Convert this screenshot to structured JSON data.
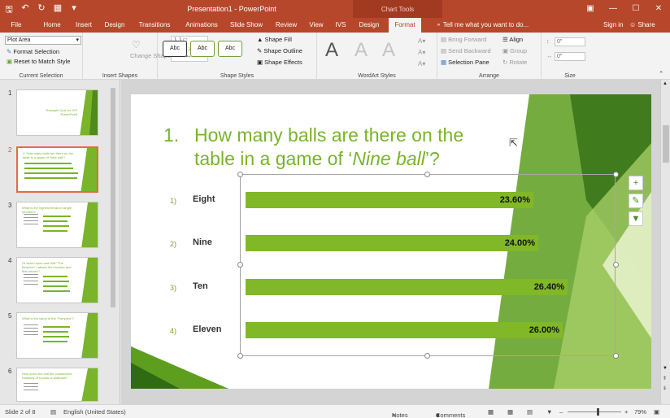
{
  "titlebar": {
    "doc_title": "Presentation1 - PowerPoint",
    "context_tab_group": "Chart Tools",
    "qat": [
      "save-icon",
      "undo-icon",
      "redo-icon",
      "start-from-beginning-icon",
      "customize-icon"
    ],
    "win_buttons": [
      "ribbon-display-icon",
      "minimize-icon",
      "maximize-icon",
      "close-icon"
    ]
  },
  "tabs": {
    "file": "File",
    "home": "Home",
    "insert": "Insert",
    "design": "Design",
    "transitions": "Transitions",
    "animations": "Animations",
    "slideshow": "Slide Show",
    "review": "Review",
    "view": "View",
    "ivs": "IVS",
    "chart_design": "Design",
    "format": "Format",
    "tell_me": "Tell me what you want to do...",
    "sign_in": "Sign in",
    "share": "Share"
  },
  "ribbon": {
    "current_selection": {
      "dropdown_value": "Plot Area",
      "format_selection": "Format Selection",
      "reset": "Reset to Match Style",
      "label": "Current Selection"
    },
    "insert_shapes": {
      "change_shape": "Change Shape",
      "label": "Insert Shapes"
    },
    "shape_styles": {
      "preset_labels": [
        "Abc",
        "Abc",
        "Abc"
      ],
      "fill": "Shape Fill",
      "outline": "Shape Outline",
      "effects": "Shape Effects",
      "label": "Shape Styles"
    },
    "wordart": {
      "letters": [
        "A",
        "A",
        "A"
      ],
      "label": "WordArt Styles"
    },
    "arrange": {
      "bring_forward": "Bring Forward",
      "send_backward": "Send Backward",
      "selection_pane": "Selection Pane",
      "align": "Align",
      "group": "Group",
      "rotate": "Rotate",
      "label": "Arrange"
    },
    "size": {
      "height": "0\"",
      "width": "0\"",
      "label": "Size"
    }
  },
  "thumbnails": [
    {
      "num": "1",
      "title": "Example Quiz for IVS PowerPoint"
    },
    {
      "num": "2",
      "title": "1. How many balls are there on the table in a game of 'Nine ball'?"
    },
    {
      "num": "3",
      "title": "What is the highest break in single snooker?"
    },
    {
      "num": "4",
      "title": "Of which sport was Will \"The Beacher\" Latham the inventor and first winner?"
    },
    {
      "num": "5",
      "title": "What is the value of the \"Pampers\"?"
    },
    {
      "num": "6",
      "title": "How does one call the consecutive rotations of rounds or plateaus?"
    }
  ],
  "slide": {
    "question_number": "1.",
    "question_line1": "How many balls are there on the",
    "question_line2_pre": "table in a game of ",
    "question_quote_open": "‘",
    "question_italic": "Nine ball",
    "question_quote_close": "’?",
    "answers": [
      {
        "num": "1)",
        "label": "Eight",
        "value": "23.60%",
        "fraction": 0.236
      },
      {
        "num": "2)",
        "label": "Nine",
        "value": "24.00%",
        "fraction": 0.24
      },
      {
        "num": "3)",
        "label": "Ten",
        "value": "26.40%",
        "fraction": 0.264
      },
      {
        "num": "4)",
        "label": "Eleven",
        "value": "26.00%",
        "fraction": 0.26
      }
    ],
    "chart_side_buttons": [
      "chart-elements-icon",
      "chart-styles-icon",
      "chart-filters-icon"
    ]
  },
  "chart_data": {
    "type": "bar",
    "orientation": "horizontal",
    "categories": [
      "Eight",
      "Nine",
      "Ten",
      "Eleven"
    ],
    "values": [
      23.6,
      24.0,
      26.4,
      26.0
    ],
    "value_labels": [
      "23.60%",
      "24.00%",
      "26.40%",
      "26.00%"
    ],
    "grid": false,
    "legend": "none"
  },
  "statusbar": {
    "slide_info": "Slide 2 of 8",
    "language": "English (United States)",
    "notes": "Notes",
    "comments": "Comments",
    "zoom": "79%"
  },
  "colors": {
    "accent": "#b7472a",
    "bar_green": "#80b827",
    "title_green": "#79b42a"
  }
}
